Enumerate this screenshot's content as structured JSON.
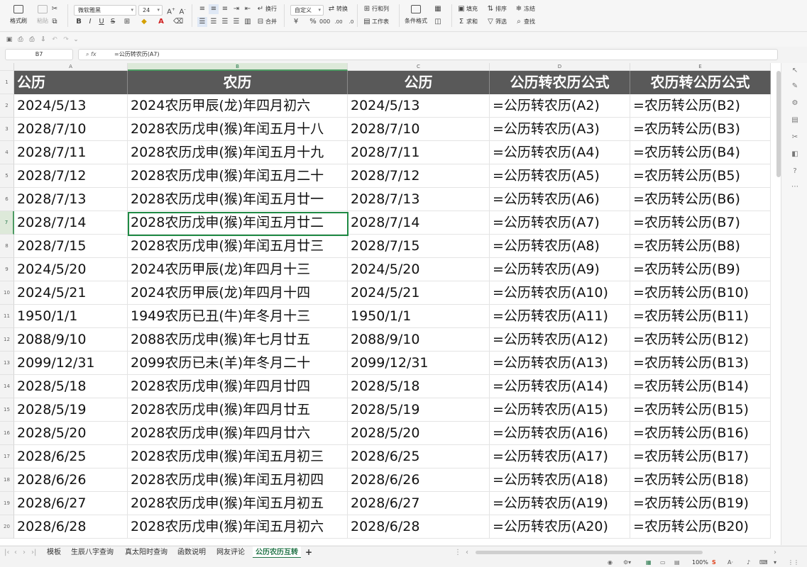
{
  "ribbon": {
    "format_painter": "格式刷",
    "paste": "粘贴",
    "font_name": "微软雅黑",
    "font_size": "24",
    "wrap": "换行",
    "merge": "合并",
    "number_format": "自定义",
    "convert": "转换",
    "rows_cols": "行和列",
    "worksheet": "工作表",
    "cond_format": "条件格式",
    "fill": "填充",
    "sort": "排序",
    "freeze": "冻结",
    "sum": "求和",
    "filter": "筛选",
    "find": "查找"
  },
  "formula_bar": {
    "cell_ref": "B7",
    "formula": "=公历转农历(A7)"
  },
  "columns": [
    "A",
    "B",
    "C",
    "D",
    "E"
  ],
  "headers": [
    "公历",
    "农历",
    "公历",
    "公历转农历公式",
    "农历转公历公式"
  ],
  "rows": [
    {
      "n": "2",
      "a": "2024/5/13",
      "b": "2024农历甲辰(龙)年四月初六",
      "c": "2024/5/13",
      "d": "=公历转农历(A2)",
      "e": "=农历转公历(B2)"
    },
    {
      "n": "3",
      "a": "2028/7/10",
      "b": "2028农历戊申(猴)年闰五月十八",
      "c": "2028/7/10",
      "d": "=公历转农历(A3)",
      "e": "=农历转公历(B3)"
    },
    {
      "n": "4",
      "a": "2028/7/11",
      "b": "2028农历戊申(猴)年闰五月十九",
      "c": "2028/7/11",
      "d": "=公历转农历(A4)",
      "e": "=农历转公历(B4)"
    },
    {
      "n": "5",
      "a": "2028/7/12",
      "b": "2028农历戊申(猴)年闰五月二十",
      "c": "2028/7/12",
      "d": "=公历转农历(A5)",
      "e": "=农历转公历(B5)"
    },
    {
      "n": "6",
      "a": "2028/7/13",
      "b": "2028农历戊申(猴)年闰五月廿一",
      "c": "2028/7/13",
      "d": "=公历转农历(A6)",
      "e": "=农历转公历(B6)"
    },
    {
      "n": "7",
      "a": "2028/7/14",
      "b": "2028农历戊申(猴)年闰五月廿二",
      "c": "2028/7/14",
      "d": "=公历转农历(A7)",
      "e": "=农历转公历(B7)"
    },
    {
      "n": "8",
      "a": "2028/7/15",
      "b": "2028农历戊申(猴)年闰五月廿三",
      "c": "2028/7/15",
      "d": "=公历转农历(A8)",
      "e": "=农历转公历(B8)"
    },
    {
      "n": "9",
      "a": "2024/5/20",
      "b": "2024农历甲辰(龙)年四月十三",
      "c": "2024/5/20",
      "d": "=公历转农历(A9)",
      "e": "=农历转公历(B9)"
    },
    {
      "n": "10",
      "a": "2024/5/21",
      "b": "2024农历甲辰(龙)年四月十四",
      "c": "2024/5/21",
      "d": "=公历转农历(A10)",
      "e": "=农历转公历(B10)"
    },
    {
      "n": "11",
      "a": "1950/1/1",
      "b": "1949农历已丑(牛)年冬月十三",
      "c": "1950/1/1",
      "d": "=公历转农历(A11)",
      "e": "=农历转公历(B11)"
    },
    {
      "n": "12",
      "a": "2088/9/10",
      "b": "2088农历戊申(猴)年七月廿五",
      "c": "2088/9/10",
      "d": "=公历转农历(A12)",
      "e": "=农历转公历(B12)"
    },
    {
      "n": "13",
      "a": "2099/12/31",
      "b": "2099农历已未(羊)年冬月二十",
      "c": "2099/12/31",
      "d": "=公历转农历(A13)",
      "e": "=农历转公历(B13)"
    },
    {
      "n": "14",
      "a": "2028/5/18",
      "b": "2028农历戊申(猴)年四月廿四",
      "c": "2028/5/18",
      "d": "=公历转农历(A14)",
      "e": "=农历转公历(B14)"
    },
    {
      "n": "15",
      "a": "2028/5/19",
      "b": "2028农历戊申(猴)年四月廿五",
      "c": "2028/5/19",
      "d": "=公历转农历(A15)",
      "e": "=农历转公历(B15)"
    },
    {
      "n": "16",
      "a": "2028/5/20",
      "b": "2028农历戊申(猴)年四月廿六",
      "c": "2028/5/20",
      "d": "=公历转农历(A16)",
      "e": "=农历转公历(B16)"
    },
    {
      "n": "17",
      "a": "2028/6/25",
      "b": "2028农历戊申(猴)年闰五月初三",
      "c": "2028/6/25",
      "d": "=公历转农历(A17)",
      "e": "=农历转公历(B17)"
    },
    {
      "n": "18",
      "a": "2028/6/26",
      "b": "2028农历戊申(猴)年闰五月初四",
      "c": "2028/6/26",
      "d": "=公历转农历(A18)",
      "e": "=农历转公历(B18)"
    },
    {
      "n": "19",
      "a": "2028/6/27",
      "b": "2028农历戊申(猴)年闰五月初五",
      "c": "2028/6/27",
      "d": "=公历转农历(A19)",
      "e": "=农历转公历(B19)"
    },
    {
      "n": "20",
      "a": "2028/6/28",
      "b": "2028农历戊申(猴)年闰五月初六",
      "c": "2028/6/28",
      "d": "=公历转农历(A20)",
      "e": "=农历转公历(B20)"
    }
  ],
  "tabs": [
    "模板",
    "生辰八字查询",
    "真太阳时查询",
    "函数说明",
    "网友评论",
    "公历农历互转"
  ],
  "active_tab": "公历农历互转",
  "status": {
    "zoom": "100%"
  },
  "colors": {
    "header_bg": "#595959",
    "accent": "#217346",
    "selection": "#1f8a44"
  }
}
